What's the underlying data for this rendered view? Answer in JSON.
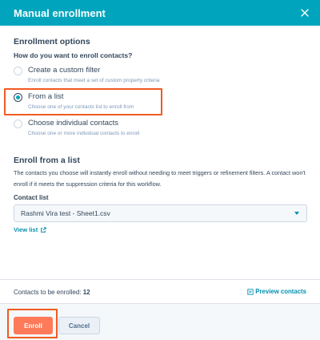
{
  "dialog": {
    "title": "Manual enrollment",
    "close_icon": "close-icon"
  },
  "enrollment_options": {
    "heading": "Enrollment options",
    "question": "How do you want to enroll contacts?",
    "selected": "from_list",
    "options": [
      {
        "label": "Create a custom filter",
        "description": "Enroll contacts that meet a set of custom property criteria"
      },
      {
        "label": "From a list",
        "description": "Choose one of your contacts list to enroll from"
      },
      {
        "label": "Choose individual contacts",
        "description": "Choose one or more individual contacts to enroll"
      }
    ]
  },
  "enroll_from_list": {
    "heading": "Enroll from a list",
    "body": "The contacts you choose will instantly enroll without needing to meet triggers or refinement filters. A contact won't enroll if it meets the suppression criteria for this workflow.",
    "contact_list_label": "Contact list",
    "contact_list_value": "Rashmi Vira test - Sheet1.csv",
    "view_list_label": "View list",
    "view_list_icon": "external-link-icon"
  },
  "summary": {
    "count_label": "Contacts to be enrolled:",
    "count_value": "12",
    "preview_label": "Preview contacts",
    "preview_icon": "preview-icon"
  },
  "footer": {
    "enroll_label": "Enroll",
    "cancel_label": "Cancel"
  },
  "colors": {
    "header": "#00a4bd",
    "link": "#0091ae",
    "primary_button": "#ff7a59",
    "highlight": "#f25a22"
  }
}
